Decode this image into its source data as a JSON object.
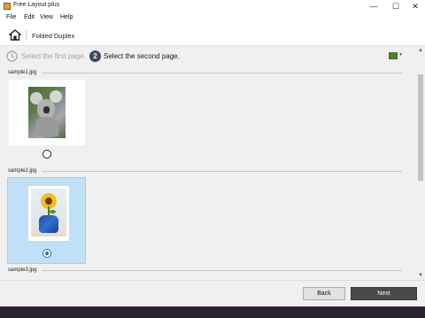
{
  "window": {
    "title": "Free Layout plus",
    "minimize_glyph": "—",
    "maximize_glyph": "☐",
    "close_glyph": "✕"
  },
  "menu": [
    "File",
    "Edit",
    "View",
    "Help"
  ],
  "header": {
    "title": "Folded Duplex",
    "home_icon": "home-icon"
  },
  "steps": {
    "step1_label": "Select the first page.",
    "step2_number": "2",
    "step2_label": "Select the second page.",
    "display_caret": "▾"
  },
  "groups": [
    {
      "filename": "sample1.jpg",
      "selected": false,
      "image": "koala-photo"
    },
    {
      "filename": "sample2.jpg",
      "selected": true,
      "image": "sunflower-photo"
    },
    {
      "filename": "sample3.jpg"
    }
  ],
  "scrollbar": {
    "up_glyph": "▲",
    "down_glyph": "▼"
  },
  "footer": {
    "back_label": "Back",
    "next_label": "Next"
  },
  "colors": {
    "selected_card": "#bfe0f6",
    "step_badge": "#3f4a59",
    "next_button": "#4a4a4a",
    "radio_accent": "#1e6fb8"
  }
}
